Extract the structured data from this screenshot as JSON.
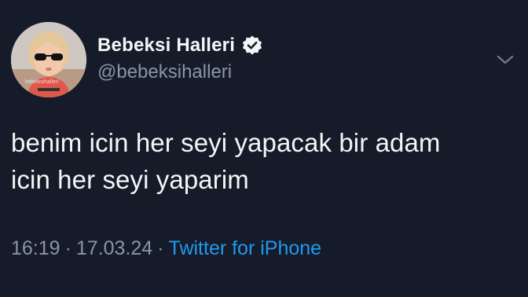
{
  "author": {
    "display_name": "Bebeksi Halleri",
    "handle": "@bebeksihalleri",
    "verified": true,
    "avatar_watermark": "bebeksihalleri"
  },
  "tweet": {
    "text": "benim icin her seyi yapacak bir adam\nicin her seyi yaparim"
  },
  "meta": {
    "time": "16:19",
    "separator": "·",
    "date": "17.03.24",
    "source": "Twitter for iPhone"
  },
  "icons": {
    "verified": "verified-check-icon",
    "more": "chevron-down-icon"
  },
  "colors": {
    "background": "#161b2a",
    "link": "#1d9bf0",
    "secondary_text": "#8a94a6"
  }
}
